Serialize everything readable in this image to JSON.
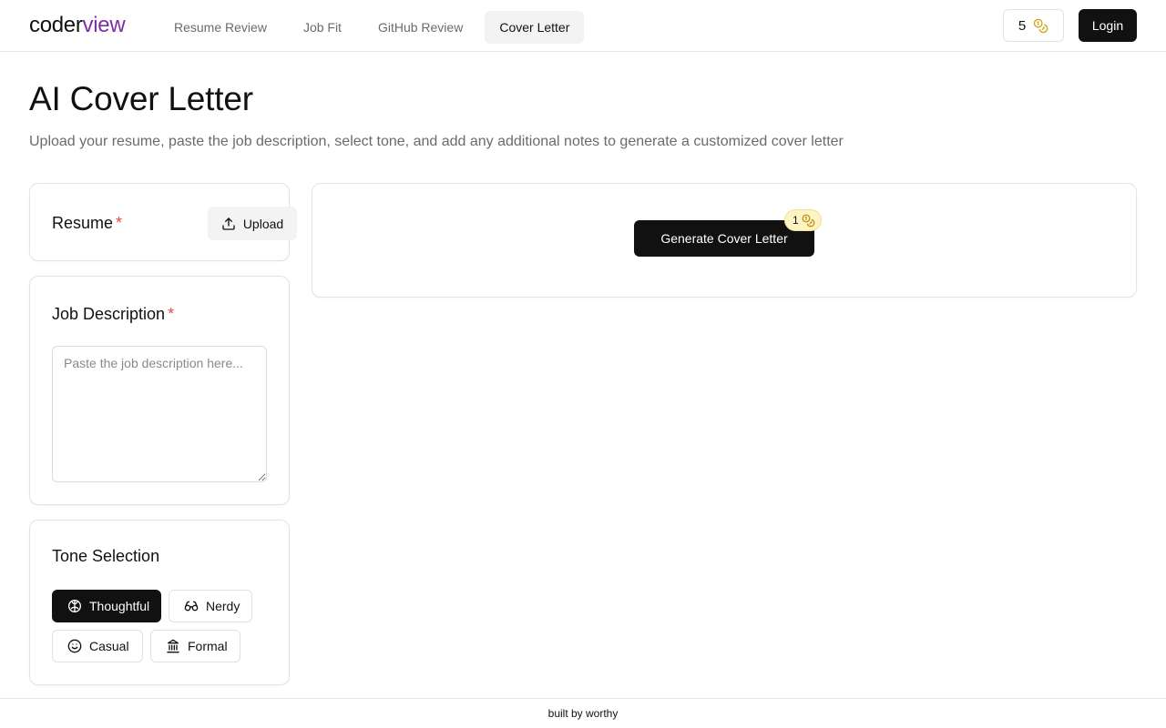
{
  "header": {
    "logo_prefix": "coder",
    "logo_accent": "view",
    "nav": [
      {
        "label": "Resume Review",
        "active": false
      },
      {
        "label": "Job Fit",
        "active": false
      },
      {
        "label": "GitHub Review",
        "active": false
      },
      {
        "label": "Cover Letter",
        "active": true
      }
    ],
    "credits": "5",
    "credits_icon": "coins-icon",
    "login_label": "Login"
  },
  "page": {
    "title": "AI Cover Letter",
    "subtitle": "Upload your resume, paste the job description, select tone, and add any additional notes to generate a customized cover letter"
  },
  "resume": {
    "label": "Resume",
    "required_mark": "*",
    "upload_label": "Upload",
    "upload_icon": "upload-icon"
  },
  "job_description": {
    "label": "Job Description",
    "required_mark": "*",
    "value": "",
    "placeholder": "Paste the job description here..."
  },
  "tone": {
    "label": "Tone Selection",
    "options": [
      {
        "label": "Thoughtful",
        "icon": "brain-icon",
        "selected": true
      },
      {
        "label": "Nerdy",
        "icon": "glasses-icon",
        "selected": false
      },
      {
        "label": "Casual",
        "icon": "smile-icon",
        "selected": false
      },
      {
        "label": "Formal",
        "icon": "landmark-icon",
        "selected": false
      }
    ]
  },
  "output": {
    "generate_label": "Generate Cover Letter",
    "cost": "1",
    "cost_icon": "coins-icon"
  },
  "footer": {
    "text": "built by worthy"
  },
  "colors": {
    "accent": "#7c2fa8",
    "primary": "#111111",
    "required": "#e5484d",
    "badge_bg": "#fdf3c4",
    "coin": "#d4a61a"
  }
}
